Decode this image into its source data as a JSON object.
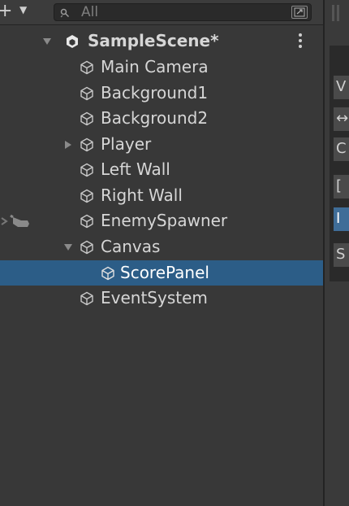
{
  "search": {
    "placeholder": "All"
  },
  "hierarchy": {
    "scene_name": "SampleScene*",
    "items": [
      {
        "label": "Main Camera"
      },
      {
        "label": "Background1"
      },
      {
        "label": "Background2"
      },
      {
        "label": "Player"
      },
      {
        "label": "Left Wall"
      },
      {
        "label": "Right Wall"
      },
      {
        "label": "EnemySpawner"
      },
      {
        "label": "Canvas"
      },
      {
        "label": "ScorePanel"
      },
      {
        "label": "EventSystem"
      }
    ]
  },
  "side_tools": [
    {
      "glyph": "V"
    },
    {
      "glyph": "↔"
    },
    {
      "glyph": "C"
    },
    {
      "glyph": "["
    },
    {
      "glyph": "I"
    },
    {
      "glyph": "S"
    }
  ],
  "colors": {
    "background": "#383838",
    "selection": "#2c5d87",
    "text": "#d6d6d6"
  }
}
